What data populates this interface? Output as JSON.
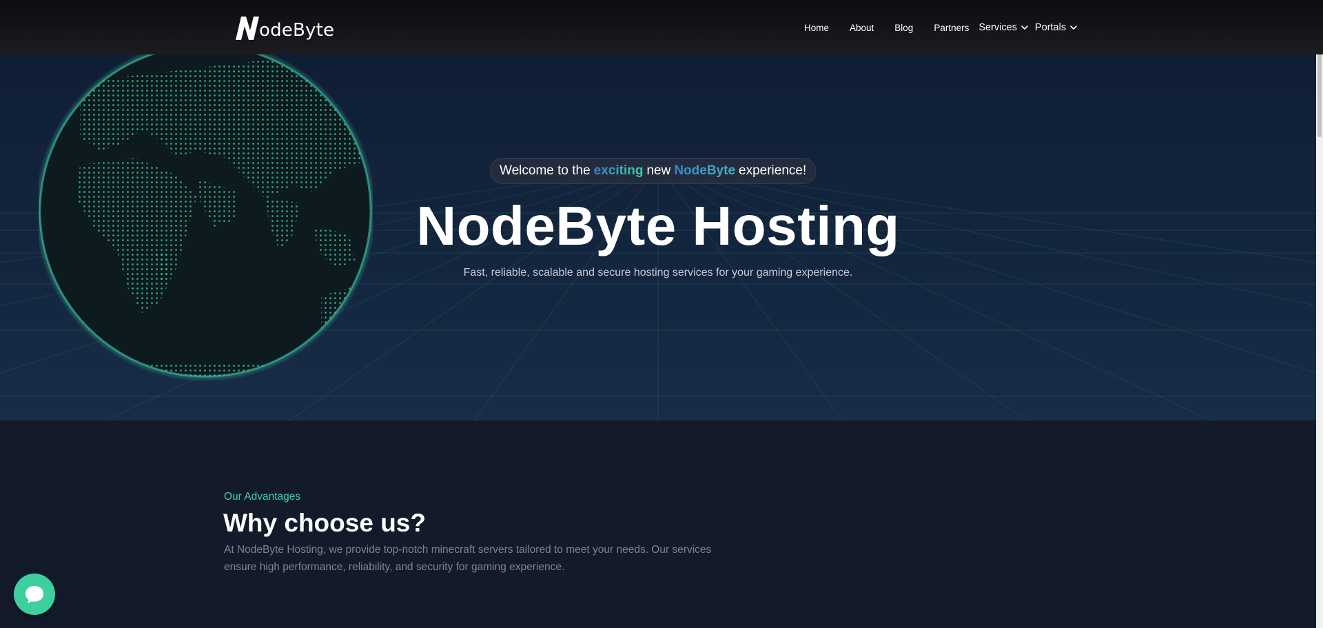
{
  "brand": {
    "logo_text": "odeByte",
    "logo_letter": "N"
  },
  "nav": {
    "links": [
      "Home",
      "About",
      "Blog",
      "Partners"
    ],
    "dropdowns": [
      "Services",
      "Portals"
    ]
  },
  "hero": {
    "badge": {
      "prefix": "Welcome to the",
      "accent1": "exciting",
      "middle": "new",
      "accent2": "NodeByte",
      "suffix": "experience!"
    },
    "title": "NodeByte Hosting",
    "subtitle": "Fast, reliable, scalable and secure hosting services for your gaming experience."
  },
  "advantages": {
    "eyebrow": "Our Advantages",
    "title": "Why choose us?",
    "description": "At NodeByte Hosting, we provide top-notch minecraft servers tailored to meet your needs. Our services ensure high performance, reliability, and security for gaming experience."
  },
  "chat": {
    "icon": "chat-bubble-icon"
  },
  "colors": {
    "accent_green": "#3fd0a5",
    "accent_blue": "#3b82c4",
    "hero_bg": "#14263f",
    "page_bg": "#131b2b",
    "navbar_bg": "#151619",
    "chat_bg": "#3ecf9f"
  }
}
